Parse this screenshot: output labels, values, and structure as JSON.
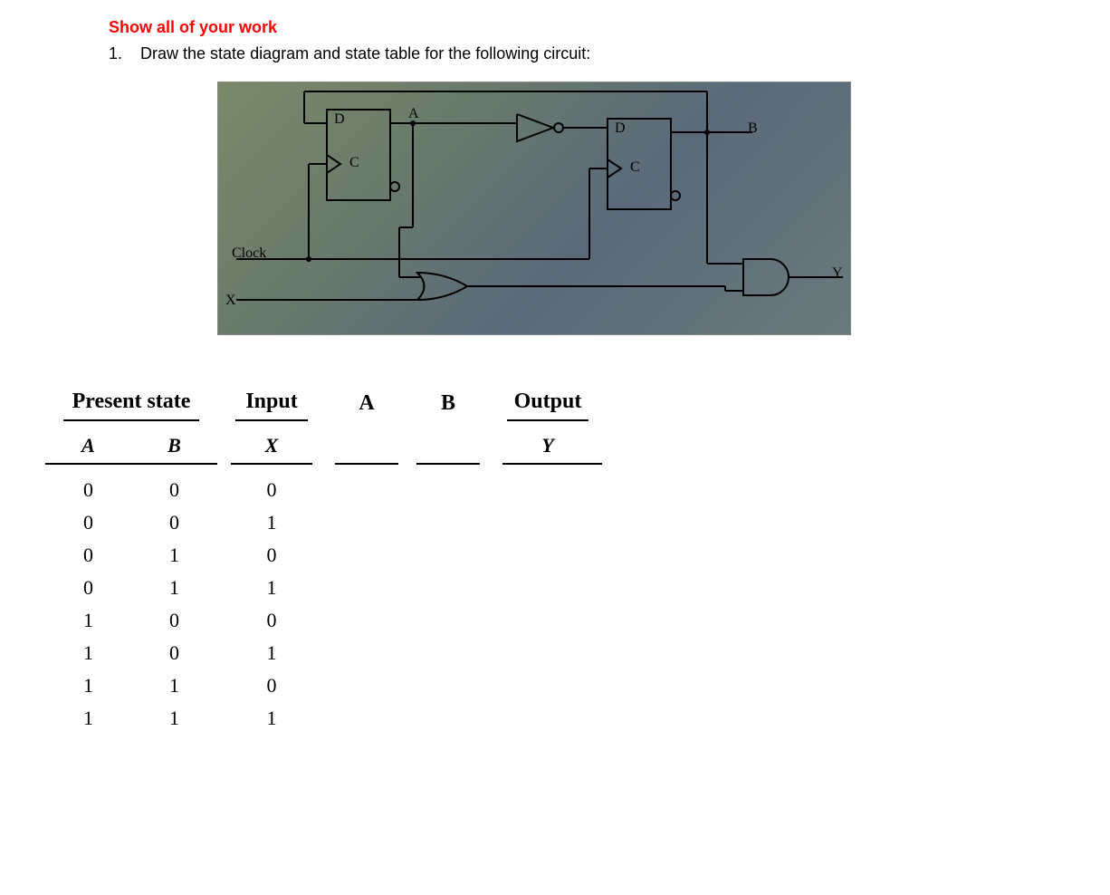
{
  "instruction": "Show all of your work",
  "question_number": "1.",
  "question_text": "Draw the state diagram and state table for the following circuit:",
  "circuit": {
    "labels": {
      "ff1_d": "D",
      "ff1_c": "C",
      "ff1_out": "A",
      "ff2_d": "D",
      "ff2_c": "C",
      "ff2_out": "B",
      "clock": "Clock",
      "input_x": "X",
      "output_y": "Y"
    }
  },
  "table": {
    "headers": {
      "present_state": "Present state",
      "input": "Input",
      "next_a": "A",
      "next_b": "B",
      "output": "Output"
    },
    "subheaders": {
      "a": "A",
      "b": "B",
      "x": "X",
      "y": "Y"
    },
    "rows": [
      {
        "a": "0",
        "b": "0",
        "x": "0"
      },
      {
        "a": "0",
        "b": "0",
        "x": "1"
      },
      {
        "a": "0",
        "b": "1",
        "x": "0"
      },
      {
        "a": "0",
        "b": "1",
        "x": "1"
      },
      {
        "a": "1",
        "b": "0",
        "x": "0"
      },
      {
        "a": "1",
        "b": "0",
        "x": "1"
      },
      {
        "a": "1",
        "b": "1",
        "x": "0"
      },
      {
        "a": "1",
        "b": "1",
        "x": "1"
      }
    ]
  }
}
